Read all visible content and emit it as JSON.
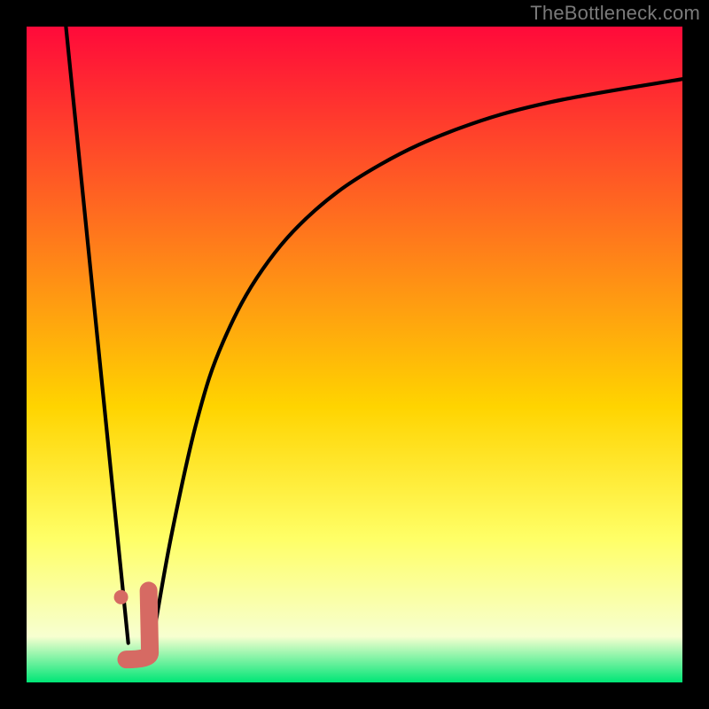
{
  "watermark": "TheBottleneck.com",
  "colors": {
    "frame": "#000000",
    "watermark": "#7a7a7a",
    "gradient_top": "#ff0a3a",
    "gradient_upper_mid": "#ff6a20",
    "gradient_mid": "#ffd400",
    "gradient_lower": "#ffff66",
    "gradient_pale": "#f7ffd0",
    "gradient_bottom": "#00e676",
    "curve": "#000000",
    "marker_fill": "#d66a63",
    "marker_stroke": "#d66a63"
  },
  "chart_data": {
    "type": "line",
    "title": "",
    "xlabel": "",
    "ylabel": "",
    "xlim": [
      0,
      100
    ],
    "ylim": [
      0,
      100
    ],
    "series": [
      {
        "name": "left-descent",
        "x": [
          6,
          15.5
        ],
        "values": [
          100,
          6
        ]
      },
      {
        "name": "right-curve",
        "x": [
          19,
          22,
          26,
          30,
          36,
          44,
          54,
          66,
          80,
          100
        ],
        "values": [
          5,
          22,
          40,
          52,
          63,
          72,
          79,
          84.5,
          88.5,
          92
        ]
      }
    ],
    "markers": [
      {
        "name": "dot",
        "x": 14.4,
        "y": 13
      },
      {
        "name": "j-segment-vertical",
        "x0": 18.6,
        "y0": 14,
        "x1": 18.8,
        "y1": 4.5
      },
      {
        "name": "j-segment-hook",
        "x0": 18.8,
        "y0": 4.5,
        "x1": 15.2,
        "y1": 3.5
      }
    ],
    "legend": false,
    "grid": false
  }
}
